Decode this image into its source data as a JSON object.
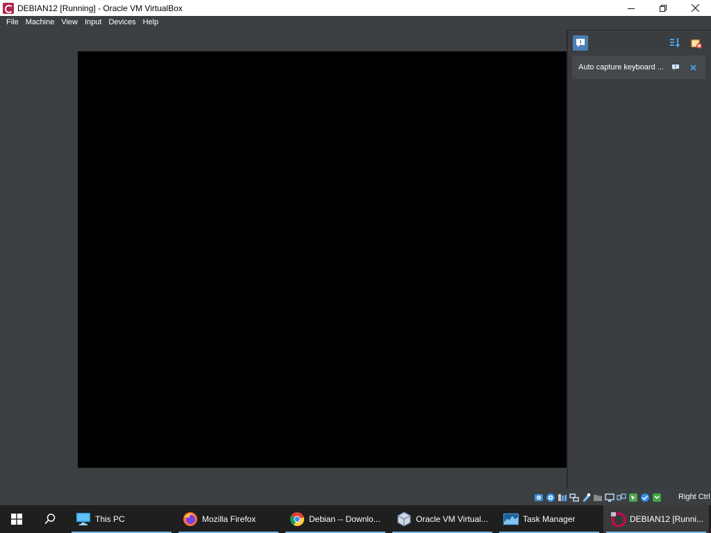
{
  "window": {
    "title": "DEBIAN12 [Running] - Oracle VM VirtualBox",
    "app_icon": "debian-vm-icon"
  },
  "window_controls": {
    "minimize_icon": "minimize-icon",
    "maximize_icon": "restore-icon",
    "close_icon": "close-icon"
  },
  "menubar": {
    "items": [
      {
        "label": "File"
      },
      {
        "label": "Machine"
      },
      {
        "label": "View"
      },
      {
        "label": "Input"
      },
      {
        "label": "Devices"
      },
      {
        "label": "Help"
      }
    ]
  },
  "vm_screen": {
    "background": "#000000"
  },
  "notification_center": {
    "toggle_icon": "notification-center-icon",
    "sort_icon": "sort-icon",
    "keep_icon": "keep-finished-icon",
    "items": [
      {
        "text": "Auto capture keyboard ...",
        "help_icon": "help-icon",
        "close_icon": "close-icon"
      }
    ]
  },
  "statusbar": {
    "icons": [
      "hard-disk-icon",
      "optical-drive-icon",
      "audio-icon",
      "network-icon",
      "usb-icon",
      "shared-folders-icon",
      "display-icon",
      "recording-icon",
      "mouse-integration-icon",
      "cpu-icon",
      "keyboard-capture-icon"
    ],
    "host_key": "Right Ctrl"
  },
  "taskbar": {
    "start_icon": "windows-start-icon",
    "search_icon": "search-icon",
    "apps": [
      {
        "label": "This PC",
        "icon": "monitor-icon",
        "active": false
      },
      {
        "label": "Mozilla Firefox",
        "icon": "firefox-icon",
        "active": false
      },
      {
        "label": "Debian -- Downlo...",
        "icon": "chrome-icon",
        "active": false
      },
      {
        "label": "Oracle VM Virtual...",
        "icon": "virtualbox-icon",
        "active": false
      },
      {
        "label": "Task Manager",
        "icon": "task-manager-icon",
        "active": false
      },
      {
        "label": "DEBIAN12 [Runni...",
        "icon": "debian-vm-icon",
        "active": true
      }
    ]
  },
  "colors": {
    "accent": "#76b9ed",
    "window_bg": "#3c3f41",
    "notification_close": "#39a0ef"
  }
}
